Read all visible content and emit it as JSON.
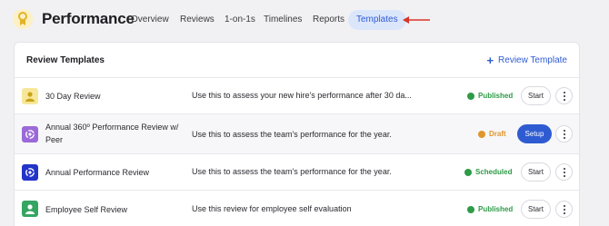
{
  "header": {
    "app_title": "Performance",
    "tabs": [
      {
        "label": "Overview",
        "active": false
      },
      {
        "label": "Reviews",
        "active": false
      },
      {
        "label": "1-on-1s",
        "active": false
      },
      {
        "label": "Timelines",
        "active": false
      },
      {
        "label": "Reports",
        "active": false
      },
      {
        "label": "Templates",
        "active": true
      }
    ],
    "accent_color": "#2f5bd2",
    "annotation_arrow_color": "#d9342b"
  },
  "card": {
    "title": "Review Templates",
    "add_button_label": "Review Template",
    "rows": [
      {
        "icon": "person-icon",
        "icon_bg": "#f7e79a",
        "name": "30 Day Review",
        "description": "Use this to assess your new hire's performance after 30 da...",
        "status": "Published",
        "status_color": "#2e9b47",
        "action": "Start"
      },
      {
        "icon": "360-icon",
        "icon_bg": "#9b6ad8",
        "name": "Annual 360º Performance Review w/ Peer",
        "description": "Use this to assess the team's performance for the year.",
        "status": "Draft",
        "status_color": "#e0962a",
        "action": "Setup"
      },
      {
        "icon": "360-icon",
        "icon_bg": "#2334c9",
        "name": "Annual Performance Review",
        "description": "Use this to assess the team's performance for the year.",
        "status": "Scheduled",
        "status_color": "#2e9b47",
        "action": "Start"
      },
      {
        "icon": "person-icon",
        "icon_bg": "#35a562",
        "name": "Employee Self Review",
        "description": "Use this review for employee self evaluation",
        "status": "Published",
        "status_color": "#2e9b47",
        "action": "Start"
      }
    ]
  }
}
